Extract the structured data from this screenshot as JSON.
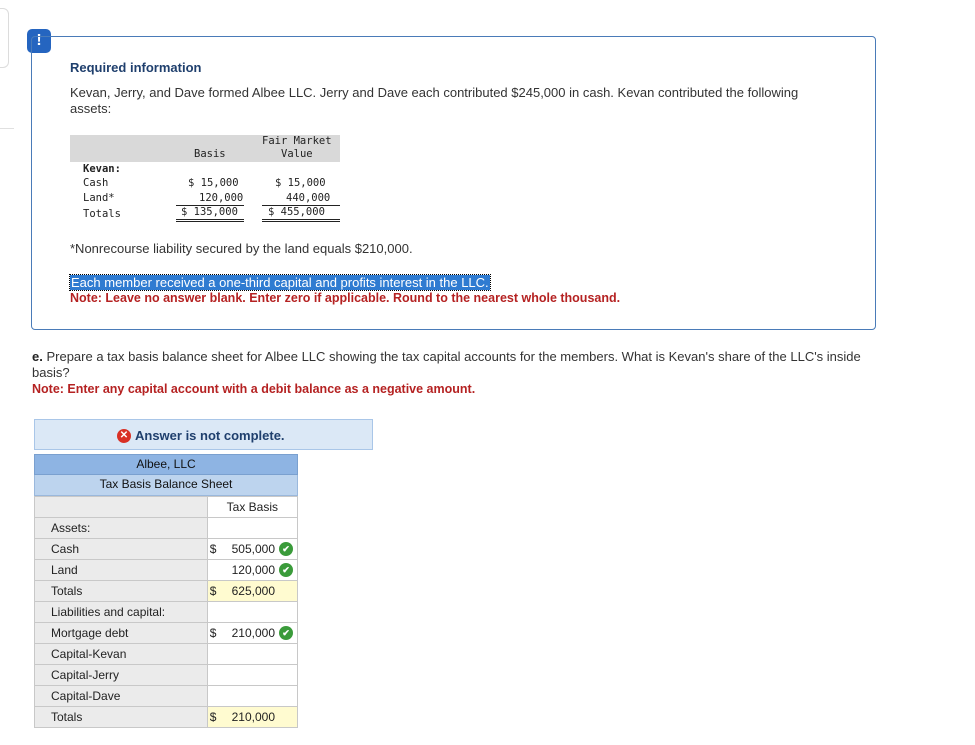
{
  "alert": {
    "icon": "exclamation-icon",
    "glyph": "!"
  },
  "info": {
    "title": "Required information",
    "description": "Kevan, Jerry, and Dave formed Albee LLC. Jerry and Dave each contributed $245,000 in cash. Kevan contributed the following assets:",
    "table": {
      "col_basis": "Basis",
      "col_fmv_line1": "Fair Market",
      "col_fmv_line2": "Value",
      "group_label": "Kevan:",
      "rows": [
        {
          "label": "Cash",
          "basis": "$ 15,000",
          "fmv": "$ 15,000"
        },
        {
          "label": "Land*",
          "basis": "120,000",
          "fmv": "440,000"
        },
        {
          "label": "Totals",
          "basis": "$ 135,000",
          "fmv": "$ 455,000"
        }
      ]
    },
    "footnote": "*Nonrecourse liability secured by the land equals $210,000.",
    "highlighted": "Each member received a one-third capital and profits interest in the LLC.",
    "note": "Note: Leave no answer blank. Enter zero if applicable. Round to the nearest whole thousand."
  },
  "question": {
    "letter": "e.",
    "text": "Prepare a tax basis balance sheet for Albee LLC showing the tax capital accounts for the members. What is Kevan's share of the LLC's inside basis?",
    "note": "Note: Enter any capital account with a debit balance as a negative amount."
  },
  "status": {
    "icon": "error-x-icon",
    "glyph": "✕",
    "text": "Answer is not complete."
  },
  "balance_sheet": {
    "company": "Albee, LLC",
    "subtitle": "Tax Basis Balance Sheet",
    "column": "Tax Basis",
    "rows": [
      {
        "label": "Assets:",
        "dollar": "",
        "value": "",
        "check": false,
        "yellow": false
      },
      {
        "label": "Cash",
        "dollar": "$",
        "value": "505,000",
        "check": true,
        "yellow": false
      },
      {
        "label": "Land",
        "dollar": "",
        "value": "120,000",
        "check": true,
        "yellow": false
      },
      {
        "label": "Totals",
        "dollar": "$",
        "value": "625,000",
        "check": false,
        "yellow": true
      },
      {
        "label": "Liabilities and capital:",
        "dollar": "",
        "value": "",
        "check": false,
        "yellow": false
      },
      {
        "label": "Mortgage debt",
        "dollar": "$",
        "value": "210,000",
        "check": true,
        "yellow": false
      },
      {
        "label": "Capital-Kevan",
        "dollar": "",
        "value": "",
        "check": false,
        "yellow": false
      },
      {
        "label": "Capital-Jerry",
        "dollar": "",
        "value": "",
        "check": false,
        "yellow": false
      },
      {
        "label": "Capital-Dave",
        "dollar": "",
        "value": "",
        "check": false,
        "yellow": false
      },
      {
        "label": "Totals",
        "dollar": "$",
        "value": "210,000",
        "check": false,
        "yellow": true
      }
    ],
    "check_glyph": "✔"
  }
}
